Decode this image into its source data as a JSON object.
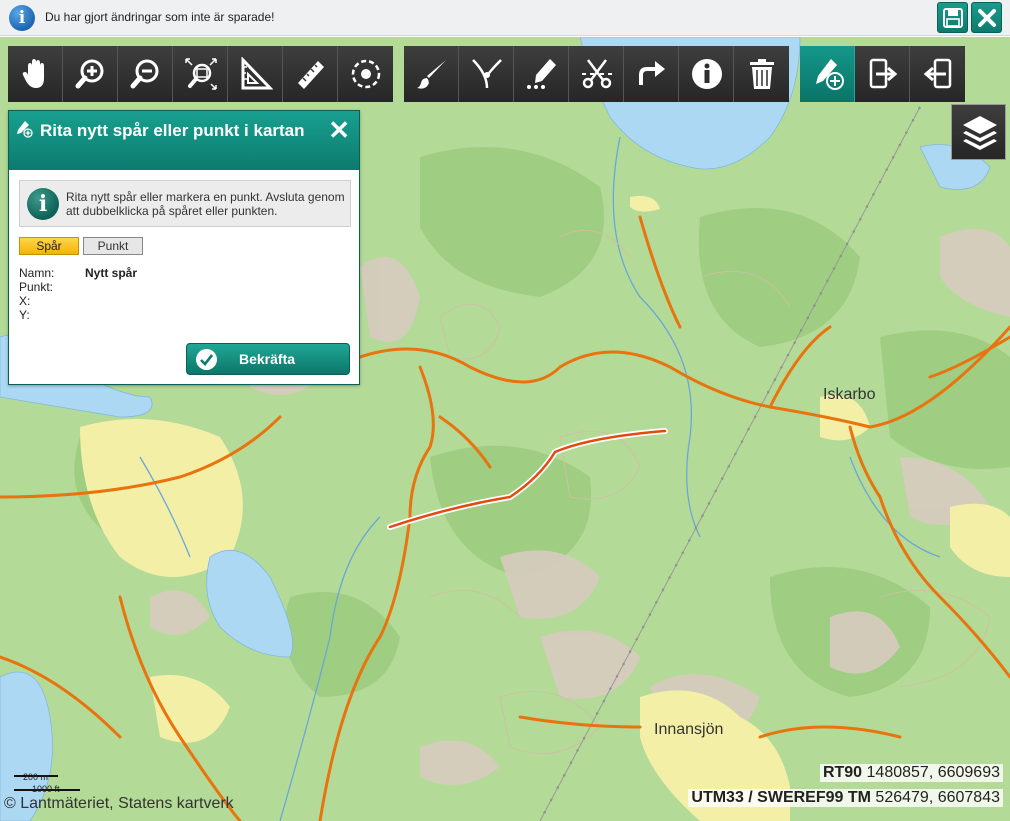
{
  "notification": {
    "message": "Du har gjort ändringar som inte är sparade!",
    "info_icon": "info-icon",
    "save_icon": "floppy-disk-icon",
    "close_icon": "close-icon"
  },
  "toolbar": {
    "group1": [
      "hand-pan-icon",
      "zoom-in-icon",
      "zoom-out-icon",
      "zoom-extent-icon",
      "triangle-ruler-icon",
      "ruler-icon",
      "locate-target-icon"
    ],
    "group2": [
      "brush-icon",
      "split-path-icon",
      "draw-points-icon",
      "scissors-icon",
      "redo-arrow-icon",
      "info-icon",
      "trash-icon"
    ],
    "group3": [
      "draw-new-icon",
      "export-to-device-icon",
      "import-from-device-icon"
    ],
    "layers_icon": "layers-icon"
  },
  "panel": {
    "title": "Rita nytt spår eller punkt i kartan",
    "close": "✕",
    "info_text": "Rita nytt spår eller markera en punkt. Avsluta genom att dubbelklicka på spåret eller punkten.",
    "modes": {
      "track": "Spår",
      "point": "Punkt",
      "selected": "Spår"
    },
    "fields": [
      {
        "label": "Namn:",
        "value": "Nytt spår"
      },
      {
        "label": "Punkt:",
        "value": ""
      },
      {
        "label": "X:",
        "value": ""
      },
      {
        "label": "Y:",
        "value": ""
      }
    ],
    "confirm_label": "Bekräfta"
  },
  "map": {
    "places": [
      "Iskarbo",
      "Innansjön"
    ],
    "scale_top": "200 m",
    "scale_bottom": "1000 ft",
    "copyright": "© Lantmäteriet, Statens kartverk",
    "coord_rt90": {
      "label": "RT90",
      "value": "1480857, 6609693"
    },
    "coord_utm": {
      "label": "UTM33 / SWEREF99 TM",
      "value": "526479, 6607843"
    },
    "colors": {
      "forest": "#a9d48c",
      "lake": "#acd8f4",
      "road": "#e8740f",
      "track": "#e24a12",
      "field": "#f6f0a9",
      "open": "#d7c9c0"
    }
  }
}
